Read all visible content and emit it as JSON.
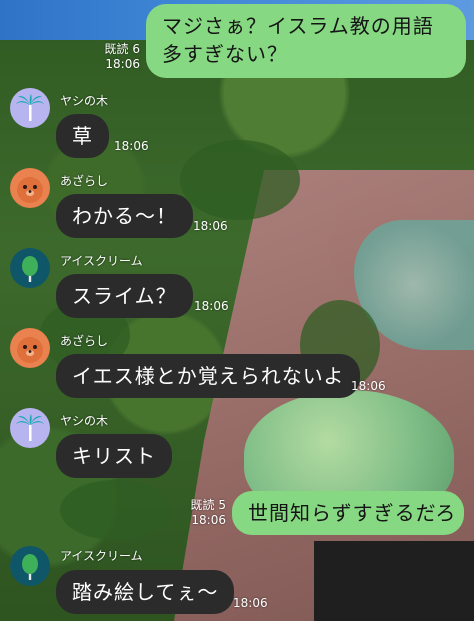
{
  "messages": [
    {
      "type": "outgoing",
      "text": "マジさぁ？イスラム教の用語多すぎない？",
      "read": "既読 6",
      "time": "18:06"
    },
    {
      "type": "incoming",
      "sender": "ヤシの木",
      "avatar": "palm-tree-icon",
      "text": "草",
      "time": "18:06"
    },
    {
      "type": "incoming",
      "sender": "あざらし",
      "avatar": "seal-icon",
      "text": "わかる〜！",
      "time": "18:06"
    },
    {
      "type": "incoming",
      "sender": "アイスクリーム",
      "avatar": "ice-cream-icon",
      "text": "スライム？",
      "time": "18:06"
    },
    {
      "type": "incoming",
      "sender": "あざらし",
      "avatar": "seal-icon",
      "text": "イエス様とか覚えられないよ",
      "time": "18:06"
    },
    {
      "type": "incoming",
      "sender": "ヤシの木",
      "avatar": "palm-tree-icon",
      "text": "キリスト",
      "time": "18:06"
    },
    {
      "type": "outgoing",
      "text": "世間知らずすぎるだろ",
      "read": "既読 5",
      "time": "18:06"
    },
    {
      "type": "incoming",
      "sender": "アイスクリーム",
      "avatar": "ice-cream-icon",
      "text": "踏み絵してぇ〜",
      "time": "18:06"
    }
  ],
  "colors": {
    "outgoing_bubble": "#86d882",
    "incoming_bubble": "#2b2b2b",
    "avatar_palm": "#b8b4f0",
    "avatar_seal": "#e9824f",
    "avatar_ice_cream": "#0f5668"
  }
}
